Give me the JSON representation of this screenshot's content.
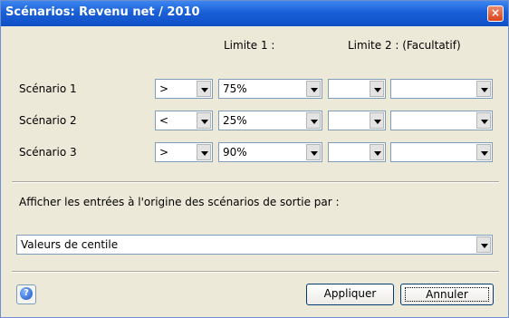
{
  "window": {
    "title": "Scénarios: Revenu net / 2010",
    "close_label": "×"
  },
  "columns": {
    "limit1": "Limite 1 :",
    "limit2": "Limite 2 : (Facultatif)"
  },
  "scenarios": [
    {
      "label": "Scénario 1",
      "op1": ">",
      "val1": "75%",
      "op2": "",
      "val2": ""
    },
    {
      "label": "Scénario 2",
      "op1": "<",
      "val1": "25%",
      "op2": "",
      "val2": ""
    },
    {
      "label": "Scénario 3",
      "op1": ">",
      "val1": "90%",
      "op2": "",
      "val2": ""
    }
  ],
  "output": {
    "label": "Afficher les entrées à l'origine des scénarios de sortie par :",
    "selected": "Valeurs de centile"
  },
  "buttons": {
    "help": "?",
    "apply": "Appliquer",
    "cancel": "Annuler"
  }
}
